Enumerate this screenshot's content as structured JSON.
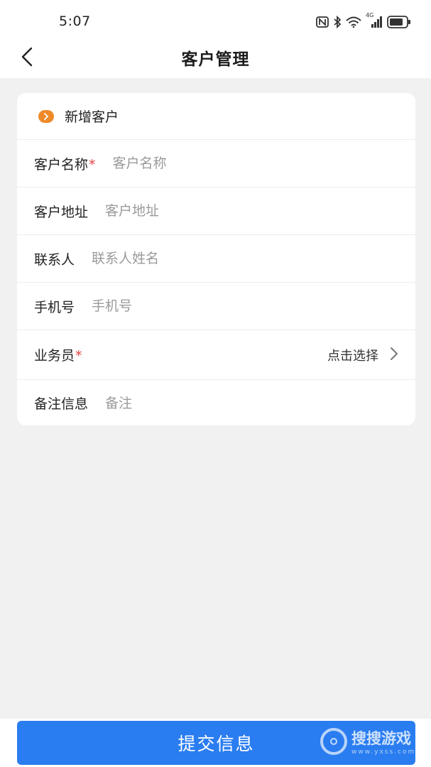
{
  "status_bar": {
    "time": "5:07",
    "network": "4G",
    "icons": [
      "nfc-icon",
      "bluetooth-icon",
      "wifi-icon",
      "signal-icon",
      "battery-icon"
    ]
  },
  "header": {
    "title": "客户管理",
    "back_icon": "chevron-left-icon"
  },
  "form": {
    "section_title": "新增客户",
    "section_icon": "chevron-right-badge-icon",
    "fields": [
      {
        "label": "客户名称",
        "required": true,
        "required_mark": "*",
        "placeholder": "客户名称",
        "value": ""
      },
      {
        "label": "客户地址",
        "required": false,
        "required_mark": "",
        "placeholder": "客户地址",
        "value": ""
      },
      {
        "label": "联系人",
        "required": false,
        "required_mark": "",
        "placeholder": "联系人姓名",
        "value": ""
      },
      {
        "label": "手机号",
        "required": false,
        "required_mark": "",
        "placeholder": "手机号",
        "value": ""
      },
      {
        "label": "业务员",
        "required": true,
        "required_mark": "*",
        "select_text": "点击选择",
        "select_icon": "chevron-right-icon"
      },
      {
        "label": "备注信息",
        "required": false,
        "required_mark": "",
        "placeholder": "备注",
        "value": ""
      }
    ]
  },
  "submit": {
    "label": "提交信息"
  },
  "watermark": {
    "text": "搜搜游戏",
    "subtext": "www.yxss.com"
  },
  "colors": {
    "accent": "#2a7df0",
    "badge": "#ef8a2a",
    "required": "#e04040",
    "background": "#f1f1f1"
  }
}
